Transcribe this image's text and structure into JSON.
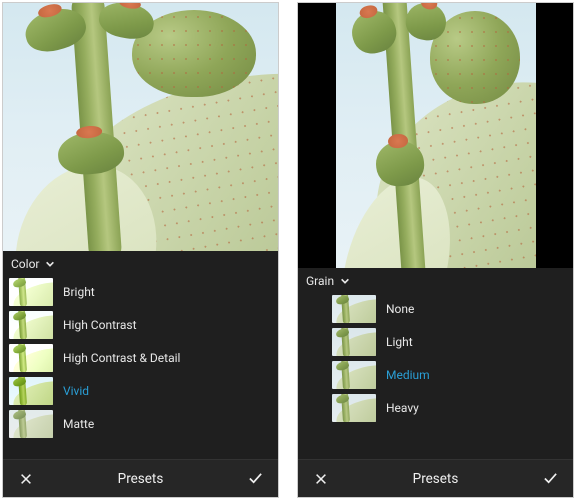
{
  "left": {
    "category_label": "Color",
    "presets": [
      {
        "label": "Bright",
        "thumb_class": "bright",
        "selected": false
      },
      {
        "label": "High Contrast",
        "thumb_class": "hc",
        "selected": false
      },
      {
        "label": "High Contrast & Detail",
        "thumb_class": "hcd",
        "selected": false
      },
      {
        "label": "Vivid",
        "thumb_class": "vivid",
        "selected": true
      },
      {
        "label": "Matte",
        "thumb_class": "matte",
        "selected": false
      }
    ],
    "bottom_title": "Presets"
  },
  "right": {
    "category_label": "Grain",
    "presets": [
      {
        "label": "None",
        "thumb_class": "none",
        "selected": false
      },
      {
        "label": "Light",
        "thumb_class": "light",
        "selected": false
      },
      {
        "label": "Medium",
        "thumb_class": "medium",
        "selected": true
      },
      {
        "label": "Heavy",
        "thumb_class": "heavy",
        "selected": false
      }
    ],
    "bottom_title": "Presets"
  },
  "colors": {
    "accent": "#2a9fd6",
    "panel_bg": "#1f1f1f",
    "bottom_bg": "#262626",
    "text": "#e8e8e8"
  }
}
